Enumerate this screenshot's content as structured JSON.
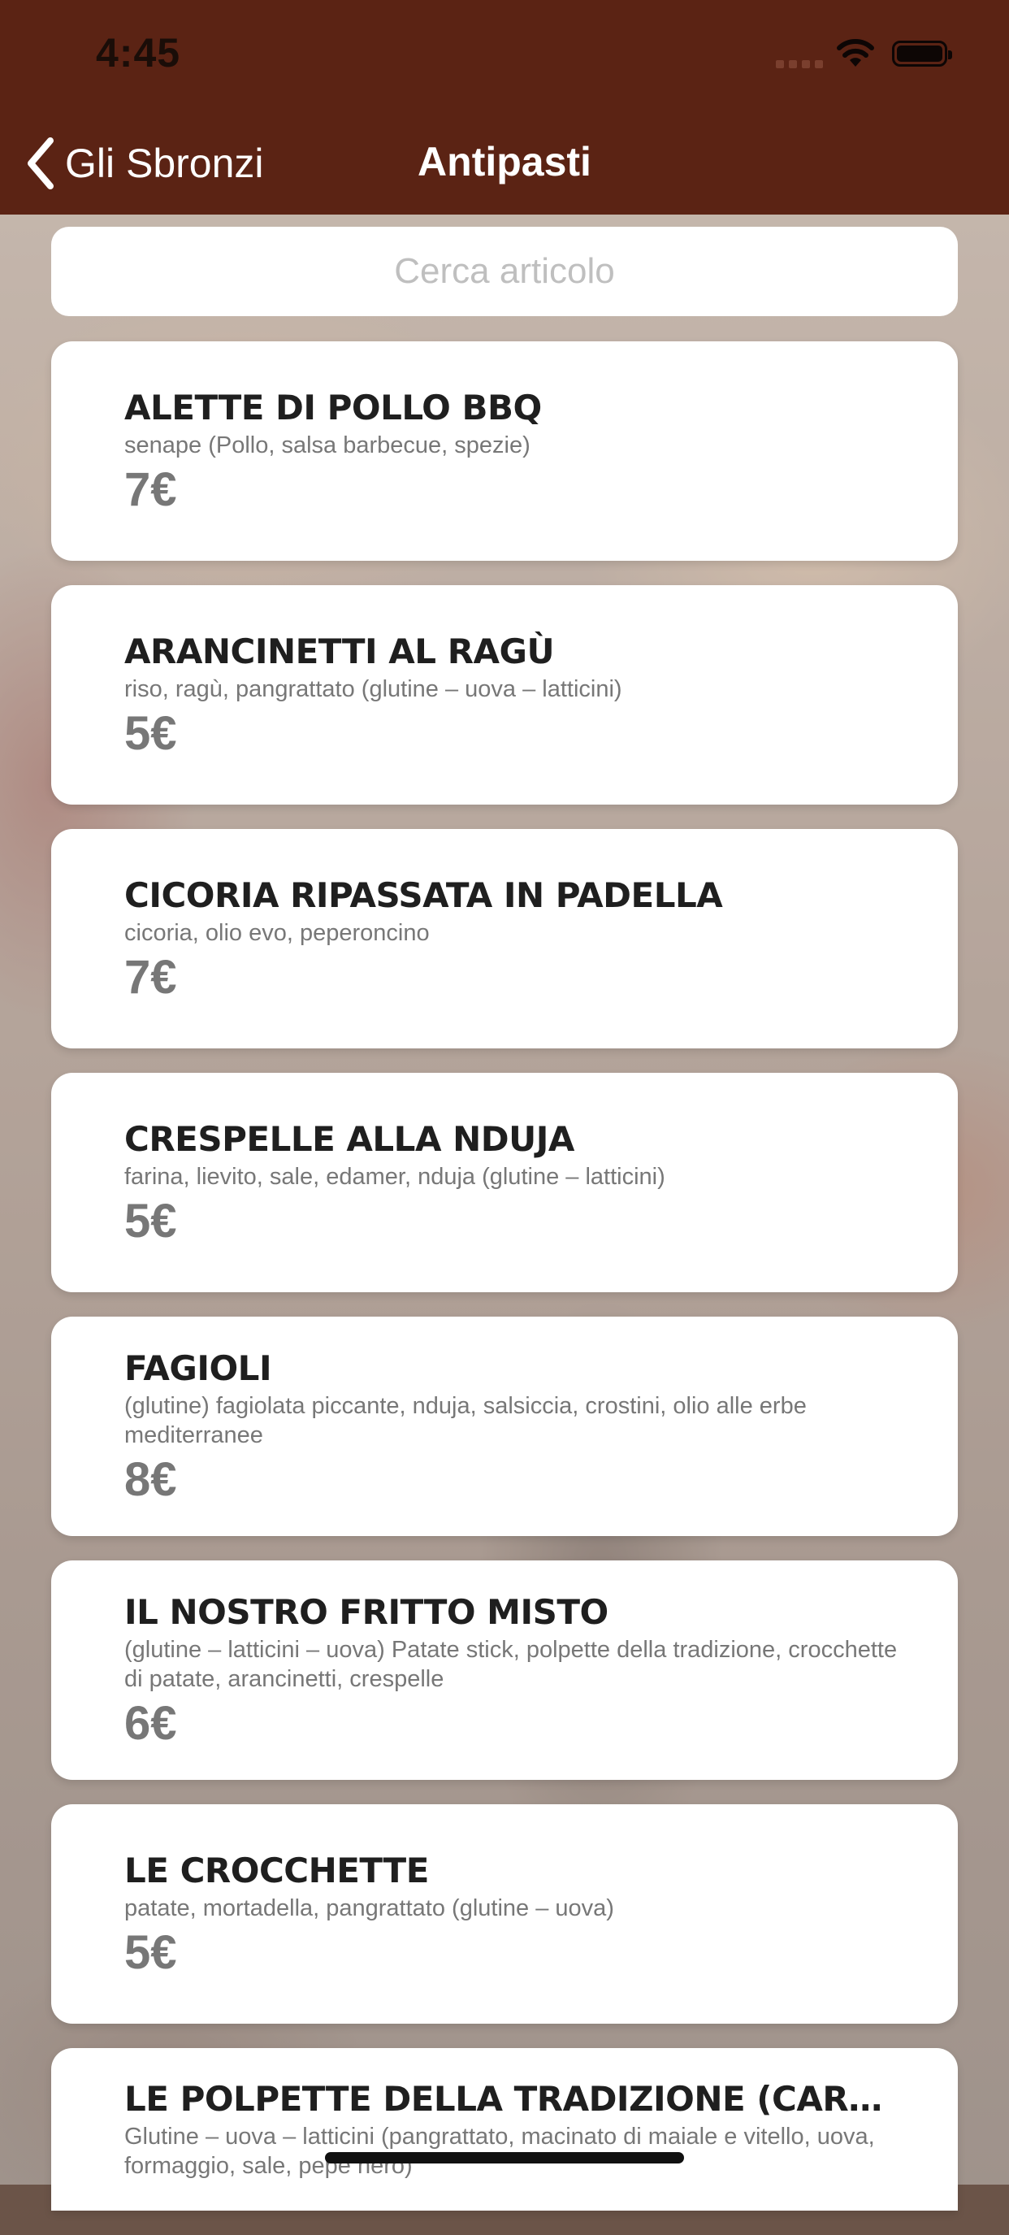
{
  "status_bar": {
    "time": "4:45"
  },
  "nav": {
    "back_label": "Gli Sbronzi",
    "title": "Antipasti"
  },
  "search": {
    "placeholder": "Cerca articolo",
    "value": ""
  },
  "items": [
    {
      "name": "ALETTE DI POLLO BBQ",
      "description": "senape (Pollo, salsa barbecue, spezie)",
      "price": "7€"
    },
    {
      "name": "ARANCINETTI AL RAGÙ",
      "description": "riso, ragù, pangrattato (glutine – uova – latticini)",
      "price": "5€"
    },
    {
      "name": "CICORIA RIPASSATA IN PADELLA",
      "description": "cicoria, olio evo, peperoncino",
      "price": "7€"
    },
    {
      "name": "CRESPELLE ALLA NDUJA",
      "description": "farina, lievito, sale, edamer, nduja (glutine – latticini)",
      "price": "5€"
    },
    {
      "name": "FAGIOLI",
      "description": "(glutine) fagiolata piccante, nduja, salsiccia, crostini, olio alle erbe mediterranee",
      "price": "8€"
    },
    {
      "name": "IL NOSTRO FRITTO MISTO",
      "description": "(glutine – latticini – uova) Patate stick, polpette della tradizione, crocchette di patate, arancinetti, crespelle",
      "price": "6€"
    },
    {
      "name": "LE CROCCHETTE",
      "description": "patate, mortadella, pangrattato (glutine – uova)",
      "price": "5€"
    },
    {
      "name": "LE POLPETTE DELLA TRADIZIONE (CARNE E...",
      "description": "Glutine – uova – latticini (pangrattato, macinato di maiale e vitello, uova, formaggio, sale, pepe nero)",
      "price": ""
    }
  ]
}
